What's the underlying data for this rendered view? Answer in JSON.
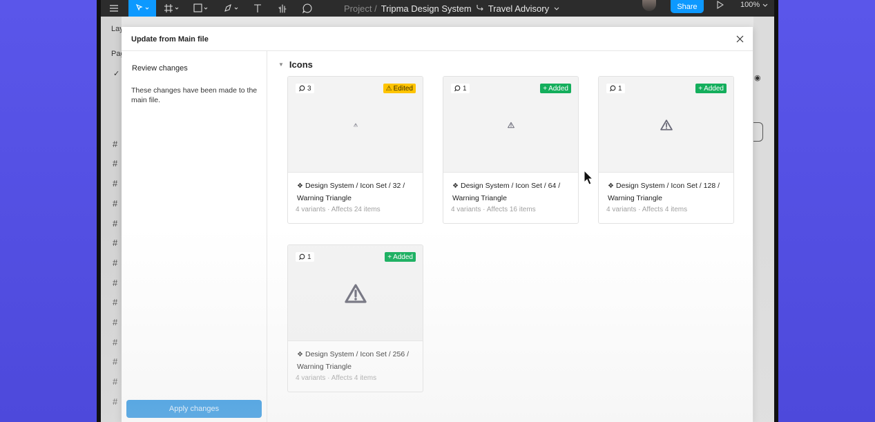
{
  "toolbar": {
    "project_label": "Project /",
    "file_name": "Tripma Design System",
    "page_name": "Travel Advisory",
    "share_label": "Share",
    "zoom": "100%",
    "icons": [
      "menu-icon",
      "move-tool-icon",
      "frame-tool-icon",
      "shape-tool-icon",
      "pen-tool-icon",
      "text-tool-icon",
      "hand-tool-icon",
      "comment-tool-icon"
    ]
  },
  "background": {
    "left_labels": [
      "Lay",
      "Pag"
    ]
  },
  "modal": {
    "title": "Update from Main file",
    "sidebar": {
      "review_label": "Review changes",
      "description": "These changes have been made to the main file.",
      "apply_label": "Apply changes"
    },
    "section_title": "Icons",
    "cards": [
      {
        "comments": "3",
        "status": "Edited",
        "status_type": "edited",
        "name": "Design System / Icon Set / 32 / Warning Triangle",
        "meta": "4 variants · Affects 24 items",
        "icon_size": 6
      },
      {
        "comments": "1",
        "status": "Added",
        "status_type": "added",
        "name": "Design System / Icon Set / 64 / Warning Triangle",
        "meta": "4 variants · Affects 16 items",
        "icon_size": 10
      },
      {
        "comments": "1",
        "status": "Added",
        "status_type": "added",
        "name": "Design System / Icon Set / 128 / Warning Triangle",
        "meta": "4 variants · Affects 4 items",
        "icon_size": 18
      },
      {
        "comments": "1",
        "status": "Added",
        "status_type": "added",
        "name": "Design System / Icon Set / 256 / Warning Triangle",
        "meta": "4 variants · Affects 4 items",
        "icon_size": 32
      }
    ]
  },
  "colors": {
    "accent": "#0d99ff",
    "added": "#14ae5c",
    "edited": "#ffc400"
  }
}
